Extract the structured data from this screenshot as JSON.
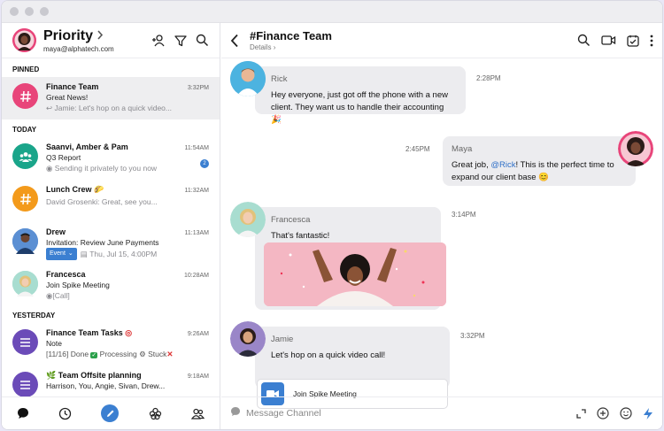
{
  "profile": {
    "title": "Priority",
    "email": "maya@alphatech.com"
  },
  "sections": {
    "pinned": "PINNED",
    "today": "TODAY",
    "yesterday": "YESTERDAY"
  },
  "conversations": [
    {
      "name": "Finance Team",
      "sub": "Great News!",
      "preview": "Jamie: Let's hop on a quick video...",
      "time": "3:32PM"
    },
    {
      "name": "Saanvi, Amber & Pam",
      "sub": "Q3 Report",
      "preview": "Sending it privately to you now",
      "time": "11:54AM",
      "badge": "2"
    },
    {
      "name": "Lunch Crew",
      "preview": "David Grosenki: Great, see you...",
      "time": "11:32AM"
    },
    {
      "name": "Drew",
      "sub": "Invitation: Review June Payments",
      "pill": "Event",
      "preview": "Thu, Jul 15, 4:00PM",
      "time": "11:13AM"
    },
    {
      "name": "Francesca",
      "sub": "Join Spike Meeting",
      "preview": "[Call]",
      "time": "10:28AM"
    },
    {
      "name": "Finance Team Tasks",
      "sub": "Note",
      "preview_parts": [
        "[11/16] Done",
        "Processing",
        "Stuck"
      ],
      "time": "9:26AM"
    },
    {
      "name": "Team Offsite planning",
      "sub": "Harrison, You, Angie, Sivan, Drew...",
      "time": "9:18AM"
    }
  ],
  "channel": {
    "title": "#Finance Team",
    "details": "Details"
  },
  "messages": [
    {
      "sender": "Rick",
      "line1": "Hey everyone, just got off the phone with a new",
      "line2": "client. They want us to handle their accounting",
      "time": "2:28PM"
    },
    {
      "sender": "Maya",
      "line1_a": "Great job, ",
      "mention": "@Rick",
      "line1_b": "! This is the perfect time to",
      "line2": "expand our client base",
      "time": "2:45PM"
    },
    {
      "sender": "Francesca",
      "line1": "That's fantastic!",
      "time": "3:14PM"
    },
    {
      "sender": "Jamie",
      "line1": "Let's hop on a quick video call!",
      "card": "Join Spike Meeting",
      "time": "3:32PM"
    }
  ],
  "composer": {
    "placeholder": "Message Channel"
  },
  "colors": {
    "accent": "#3b7fd1",
    "pink": "#e8457a",
    "teal": "#1aa58a",
    "orange": "#f39a1b",
    "purple": "#6b4bb8"
  }
}
